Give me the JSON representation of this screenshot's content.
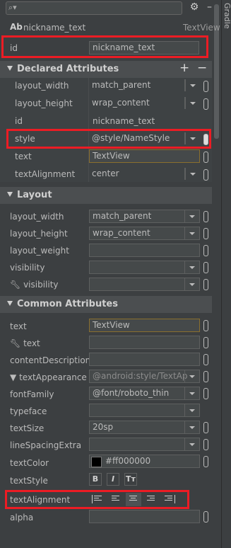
{
  "toolbar": {
    "search_placeholder": "",
    "gear_icon": "gear-icon",
    "minus_icon": "minus-icon"
  },
  "side_tab": {
    "label": "Gradle"
  },
  "component": {
    "badge": "Ab",
    "name": "nickname_text",
    "type": "TextView"
  },
  "id_field": {
    "label": "id",
    "value": "nickname_text"
  },
  "declared": {
    "title": "Declared Attributes",
    "add_label": "+",
    "remove_label": "−",
    "rows": [
      {
        "label": "layout_width",
        "value": "match_parent"
      },
      {
        "label": "layout_height",
        "value": "wrap_content"
      },
      {
        "label": "id",
        "value": "nickname_text"
      },
      {
        "label": "style",
        "value": "@style/NameStyle"
      },
      {
        "label": "text",
        "value": "TextView"
      },
      {
        "label": "textAlignment",
        "value": "center"
      }
    ]
  },
  "layout": {
    "title": "Layout",
    "rows": [
      {
        "label": "layout_width",
        "value": "match_parent"
      },
      {
        "label": "layout_height",
        "value": "wrap_content"
      },
      {
        "label": "layout_weight",
        "value": ""
      },
      {
        "label": "visibility",
        "value": ""
      },
      {
        "label": "visibility",
        "value": ""
      }
    ]
  },
  "common": {
    "title": "Common Attributes",
    "rows": [
      {
        "label": "text",
        "value": "TextView"
      },
      {
        "label": "text",
        "value": ""
      },
      {
        "label": "contentDescription",
        "value": ""
      },
      {
        "label": "textAppearance",
        "value": "@android:style/TextAp"
      },
      {
        "label": "fontFamily",
        "value": "@font/roboto_thin"
      },
      {
        "label": "typeface",
        "value": ""
      },
      {
        "label": "textSize",
        "value": "20sp"
      },
      {
        "label": "lineSpacingExtra",
        "value": ""
      },
      {
        "label": "textColor",
        "value": "#ff000000"
      },
      {
        "label": "textStyle",
        "value": ""
      },
      {
        "label": "textAlignment",
        "value": ""
      },
      {
        "label": "alpha",
        "value": ""
      }
    ],
    "text_style_buttons": [
      "B",
      "I",
      "Tт"
    ],
    "alignment_selected": "center"
  },
  "colors": {
    "highlight": "#ec1c24",
    "text_color_swatch": "#000000"
  }
}
